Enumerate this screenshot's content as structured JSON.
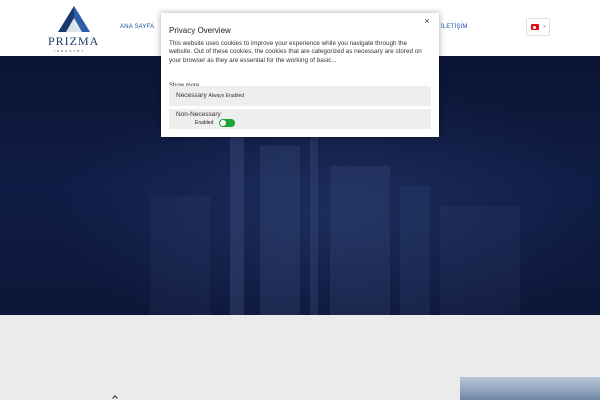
{
  "header": {
    "logo_text": "PRIZMA",
    "logo_sub": "INDUSTRY",
    "nav": [
      {
        "label": "ANA SAYFA"
      },
      {
        "label": "İLETİŞİM"
      }
    ],
    "language": {
      "flag": "tr-flag-icon",
      "caret": "⌄"
    }
  },
  "cookie_modal": {
    "close": "×",
    "title": "Privacy Overview",
    "body": "This website uses cookies to improve your experience while you navigate through the website. Out of these cookies, the cookies that are categorized as necessary are stored on your browser as they are essential for the working of basic...",
    "show_more": "Show more",
    "categories": [
      {
        "label": "Necessary",
        "status": "Always Enabled"
      },
      {
        "label": "Non-Necessary",
        "status": "Enabled",
        "toggle_on": true
      }
    ]
  },
  "colors": {
    "brand": "#1a3a6b",
    "nav": "#1e4fa8",
    "hero_bg": "#0f1c45",
    "toggle_on": "#1aa33a"
  }
}
